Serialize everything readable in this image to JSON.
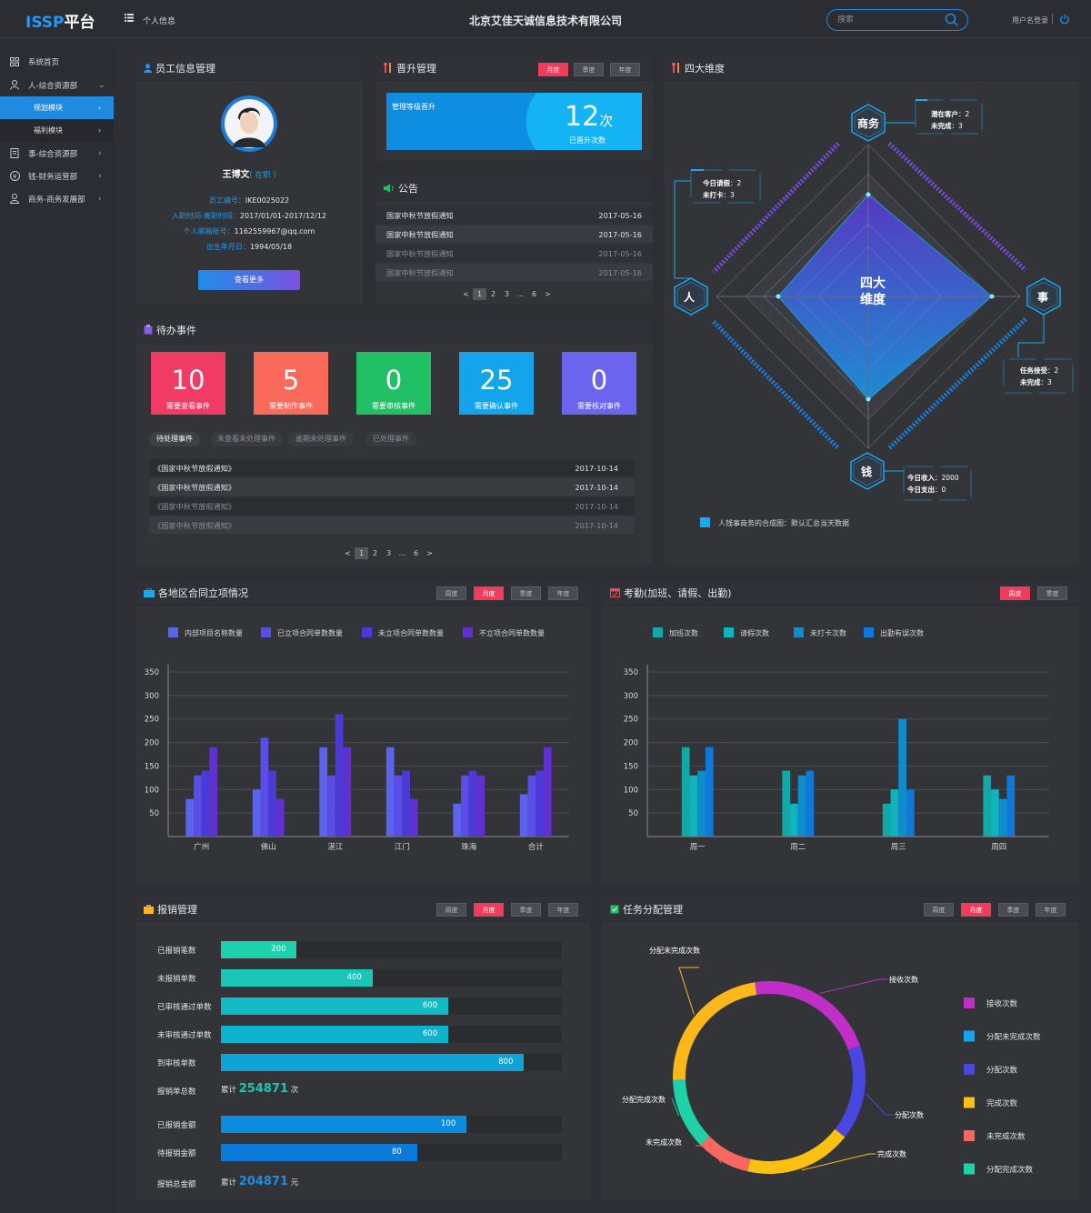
{
  "header": {
    "logo_main": "ISSP",
    "logo_sub": "平台",
    "personal_info": "个人信息",
    "company": "北京艾佳天诚信息技术有限公司",
    "search_placeholder": "搜索",
    "user_login": "用户名登录"
  },
  "sidebar": {
    "items": [
      {
        "label": "系统首页",
        "icon": "grid-icon"
      },
      {
        "label": "人-综合资源部",
        "icon": "person-icon",
        "expanded": true
      },
      {
        "label": "规划模块",
        "active": true
      },
      {
        "label": "福利模块"
      },
      {
        "label": "事-综合资源部",
        "icon": "document-icon"
      },
      {
        "label": "钱-财务运营部",
        "icon": "money-icon"
      },
      {
        "label": "商务-商务发展部",
        "icon": "user-icon"
      }
    ]
  },
  "staff": {
    "title": "员工信息管理",
    "name": "王博文",
    "status": "( 在职 )",
    "fields": [
      {
        "label": "员工编号：",
        "value": "IKE0025022"
      },
      {
        "label": "入职时间-离职时间：",
        "value": "2017/01/01-2017/12/12"
      },
      {
        "label": "个人邮箱账号：",
        "value": "1162559967@qq.com"
      },
      {
        "label": "出生年月日：",
        "value": "1994/05/18"
      }
    ],
    "more_button": "查看更多"
  },
  "promotion": {
    "title": "晋升管理",
    "tabs": [
      "月度",
      "季度",
      "年度"
    ],
    "active_tab": "月度",
    "label": "管理等级晋升",
    "count": "12",
    "unit": "次",
    "sub": "已晋升次数"
  },
  "notice": {
    "title": "公告",
    "rows": [
      {
        "text": "国家中秋节放假通知",
        "date": "2017-05-16",
        "read": false
      },
      {
        "text": "国家中秋节放假通知",
        "date": "2017-05-16",
        "read": false
      },
      {
        "text": "国家中秋节放假通知",
        "date": "2017-05-16",
        "read": true
      },
      {
        "text": "国家中秋节放假通知",
        "date": "2017-05-16",
        "read": true
      }
    ],
    "pager": [
      "<",
      "1",
      "2",
      "3",
      "...",
      "6",
      ">"
    ]
  },
  "dimensions": {
    "title": "四大维度",
    "center": [
      "四大",
      "维度"
    ],
    "nodes": {
      "top": "商务",
      "left": "人",
      "right": "事",
      "bottom": "钱"
    },
    "callouts": {
      "top": [
        {
          "k": "潜在客户",
          "v": "：2"
        },
        {
          "k": "未完成",
          "v": "：3"
        }
      ],
      "left": [
        {
          "k": "今日请假",
          "v": "：2"
        },
        {
          "k": "未打卡",
          "v": "：3"
        }
      ],
      "right": [
        {
          "k": "任务接受",
          "v": "：2"
        },
        {
          "k": "未完成",
          "v": "：3"
        }
      ],
      "bottom": [
        {
          "k": "今日收入",
          "v": "：2000"
        },
        {
          "k": "今日支出",
          "v": "：0"
        }
      ]
    },
    "legend": "人钱事商务的合成图：默认汇总当天数据",
    "legend_color": "#1aa8f0"
  },
  "todo": {
    "title": "待办事件",
    "cards": [
      {
        "num": "10",
        "label": "需要查看事件",
        "color": "#f03c64"
      },
      {
        "num": "5",
        "label": "需要制作事件",
        "color": "#fa6a5a"
      },
      {
        "num": "0",
        "label": "需要审核事件",
        "color": "#22c064"
      },
      {
        "num": "25",
        "label": "需要确认事件",
        "color": "#14a4ec"
      },
      {
        "num": "0",
        "label": "需要核对事件",
        "color": "#6a64ee"
      }
    ],
    "tabs": [
      "待处理事件",
      "未查看未处理事件",
      "逾期未处理事件",
      "已处理事件"
    ],
    "rows": [
      {
        "text": "《国家中秋节放假通知》",
        "date": "2017-10-14",
        "read": false
      },
      {
        "text": "《国家中秋节放假通知》",
        "date": "2017-10-14",
        "read": false
      },
      {
        "text": "《国家中秋节放假通知》",
        "date": "2017-10-14",
        "read": true
      },
      {
        "text": "《国家中秋节放假通知》",
        "date": "2017-10-14",
        "read": true
      }
    ],
    "pager": [
      "<",
      "1",
      "2",
      "3",
      "...",
      "6",
      ">"
    ]
  },
  "contract": {
    "title": "各地区合同立项情况",
    "tabs": [
      "周度",
      "月度",
      "季度",
      "年度"
    ],
    "active_tab": "月度"
  },
  "attendance": {
    "title": "考勤(加班、请假、出勤)",
    "tabs": [
      "周度",
      "季度"
    ],
    "active_tab": "周度"
  },
  "reimburse": {
    "title": "报销管理",
    "tabs": [
      "周度",
      "月度",
      "季度",
      "年度"
    ],
    "active_tab": "月度",
    "bars": [
      {
        "label": "已报销笔数",
        "value": 200,
        "color": "#1ed0ac"
      },
      {
        "label": "未报销单数",
        "value": 400,
        "color": "#1ac6b8"
      },
      {
        "label": "已审核通过单数",
        "value": 600,
        "color": "#12bcc6"
      },
      {
        "label": "未审核通过单数",
        "value": 600,
        "color": "#0eb2cc"
      },
      {
        "label": "到审核单数",
        "value": 800,
        "color": "#0ea4d8"
      }
    ],
    "total_label": "报销单总数",
    "total_prefix": "累计",
    "total_value": "254871",
    "total_unit": "次",
    "total_color": "#1ec6b4",
    "amount_bars": [
      {
        "label": "已报销金额",
        "value": 100,
        "color": "#0c8cde"
      },
      {
        "label": "待报销金额",
        "value": 80,
        "color": "#0c7ad8"
      }
    ],
    "amount_label": "报销总金额",
    "amount_prefix": "累计",
    "amount_value": "204871",
    "amount_unit": "元",
    "amount_color": "#1a8ee8"
  },
  "task": {
    "title": "任务分配管理",
    "tabs": [
      "周度",
      "月度",
      "季度",
      "年度"
    ],
    "active_tab": "月度"
  },
  "chart_data": [
    {
      "type": "bar",
      "categories": [
        "广州",
        "佛山",
        "湛江",
        "江门",
        "珠海",
        "合计"
      ],
      "series": [
        {
          "name": "内部项目名称数量",
          "values": [
            80,
            100,
            190,
            190,
            70,
            90
          ],
          "color": "#5c63ec"
        },
        {
          "name": "已立项合同单数数量",
          "values": [
            130,
            210,
            130,
            130,
            130,
            130
          ],
          "color": "#5a4ee8"
        },
        {
          "name": "未立项合同单数数量",
          "values": [
            140,
            140,
            260,
            140,
            140,
            140
          ],
          "color": "#4c3ad8"
        },
        {
          "name": "不立项合同单数数量",
          "values": [
            190,
            80,
            190,
            80,
            130,
            190
          ],
          "color": "#6030d0"
        }
      ],
      "yticks": [
        50,
        100,
        150,
        200,
        250,
        300,
        350
      ],
      "ylim": [
        0,
        350
      ]
    },
    {
      "type": "bar",
      "categories": [
        "周一",
        "周二",
        "周三",
        "周四"
      ],
      "series": [
        {
          "name": "加班次数",
          "values": [
            190,
            140,
            70,
            130
          ],
          "color": "#12a8a8"
        },
        {
          "name": "请假次数",
          "values": [
            130,
            70,
            100,
            100
          ],
          "color": "#10b4bc"
        },
        {
          "name": "未打卡次数",
          "values": [
            140,
            130,
            250,
            80
          ],
          "color": "#108ccc"
        },
        {
          "name": "出勤有误次数",
          "values": [
            190,
            140,
            100,
            130
          ],
          "color": "#1078d8"
        }
      ],
      "yticks": [
        50,
        100,
        150,
        200,
        250,
        300,
        350
      ],
      "ylim": [
        0,
        350
      ]
    },
    {
      "type": "pie",
      "labels": [
        "接收次数",
        "分配次数",
        "完成次数",
        "未完成次数",
        "分配完成次数",
        "分配未完成次数"
      ],
      "values": [
        22,
        16,
        18,
        9,
        12,
        23
      ],
      "colors": [
        "#c030c8",
        "#4848e0",
        "#fcc010",
        "#f86860",
        "#20d0a8",
        "#fcb818"
      ],
      "legend": [
        {
          "name": "接收次数",
          "color": "#c030c8"
        },
        {
          "name": "分配未完成次数",
          "color": "#12a8f0"
        },
        {
          "name": "分配次数",
          "color": "#4848e0"
        },
        {
          "name": "完成次数",
          "color": "#fcc010"
        },
        {
          "name": "未完成次数",
          "color": "#f86860"
        },
        {
          "name": "分配完成次数",
          "color": "#20d0a8"
        }
      ]
    }
  ]
}
